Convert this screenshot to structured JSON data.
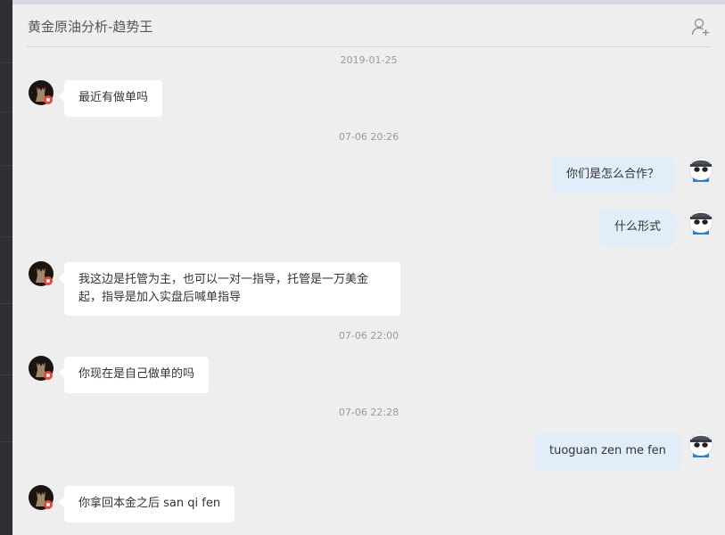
{
  "chat": {
    "title": "黄金原油分析-趋势王",
    "timestamps": [
      "2019-01-25",
      "07-06 20:26",
      "07-06 22:00",
      "07-06 22:28"
    ],
    "messages": [
      {
        "side": "left",
        "text": "最近有做单吗"
      },
      {
        "side": "right",
        "text": "你们是怎么合作？"
      },
      {
        "side": "right",
        "text": "什么形式"
      },
      {
        "side": "left",
        "text": "我这边是托管为主，也可以一对一指导，托管是一万美金起，指导是加入实盘后喊单指导"
      },
      {
        "side": "left",
        "text": "你现在是自己做单的吗"
      },
      {
        "side": "right",
        "text": "tuoguan  zen  me fen"
      },
      {
        "side": "left",
        "text": "你拿回本金之后 san qi fen"
      }
    ]
  },
  "icons": {
    "header_action": "add-user-icon",
    "contact_avatar": "contact-avatar",
    "self_avatar": "panda-avatar"
  },
  "colors": {
    "background": "#eeeeee",
    "left_bubble": "#ffffff",
    "right_bubble": "#e1eef9",
    "sidebar": "#2e2f33"
  }
}
